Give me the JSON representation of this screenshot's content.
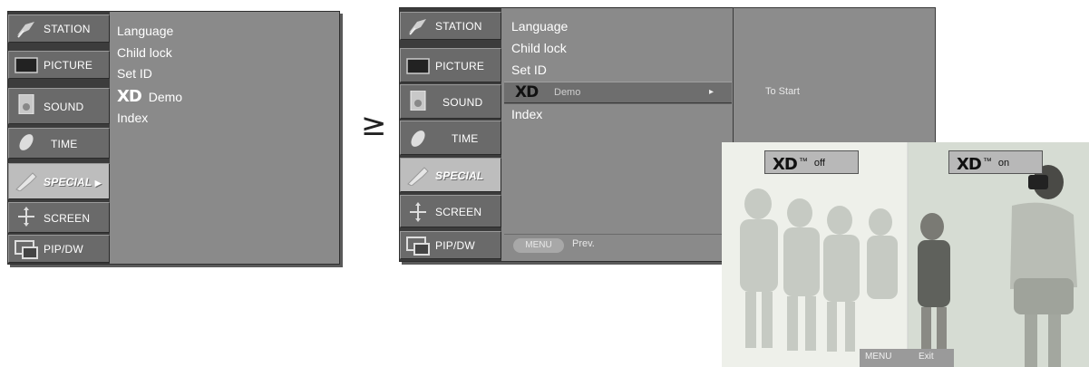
{
  "sidebar_items": [
    {
      "label": "STATION",
      "icon": "satellite-icon"
    },
    {
      "label": "PICTURE",
      "icon": "picture-icon"
    },
    {
      "label": "SOUND",
      "icon": "speaker-icon"
    },
    {
      "label": "TIME",
      "icon": "clock-icon"
    },
    {
      "label": "SPECIAL",
      "icon": "wrench-icon"
    },
    {
      "label": "SCREEN",
      "icon": "screen-adjust-icon"
    },
    {
      "label": "PIP/DW",
      "icon": "pip-icon"
    }
  ],
  "left_menu": {
    "active_suffix": "▶",
    "items": [
      "Language",
      "Child lock",
      "Set ID",
      "Demo",
      "Index"
    ],
    "xd_logo": "XD"
  },
  "arrow": "≥",
  "right_menu": {
    "items": [
      "Language",
      "Child lock",
      "Set ID",
      "Demo",
      "Index"
    ],
    "xd_logo": "XD",
    "selected_arrow": "▸",
    "submenu_option": "To Start",
    "footer_button": "MENU",
    "footer_label": "Prev."
  },
  "demo": {
    "badge_off": {
      "logo": "XD",
      "tm": "™",
      "state": "off"
    },
    "badge_on": {
      "logo": "XD",
      "tm": "™",
      "state": "on"
    },
    "footer_button": "MENU",
    "footer_label": "Exit"
  },
  "colors": {
    "panel": "#8a8a8a",
    "sidebar_active": "#bdbdbd",
    "sidebar_item": "#6a6a6a"
  }
}
